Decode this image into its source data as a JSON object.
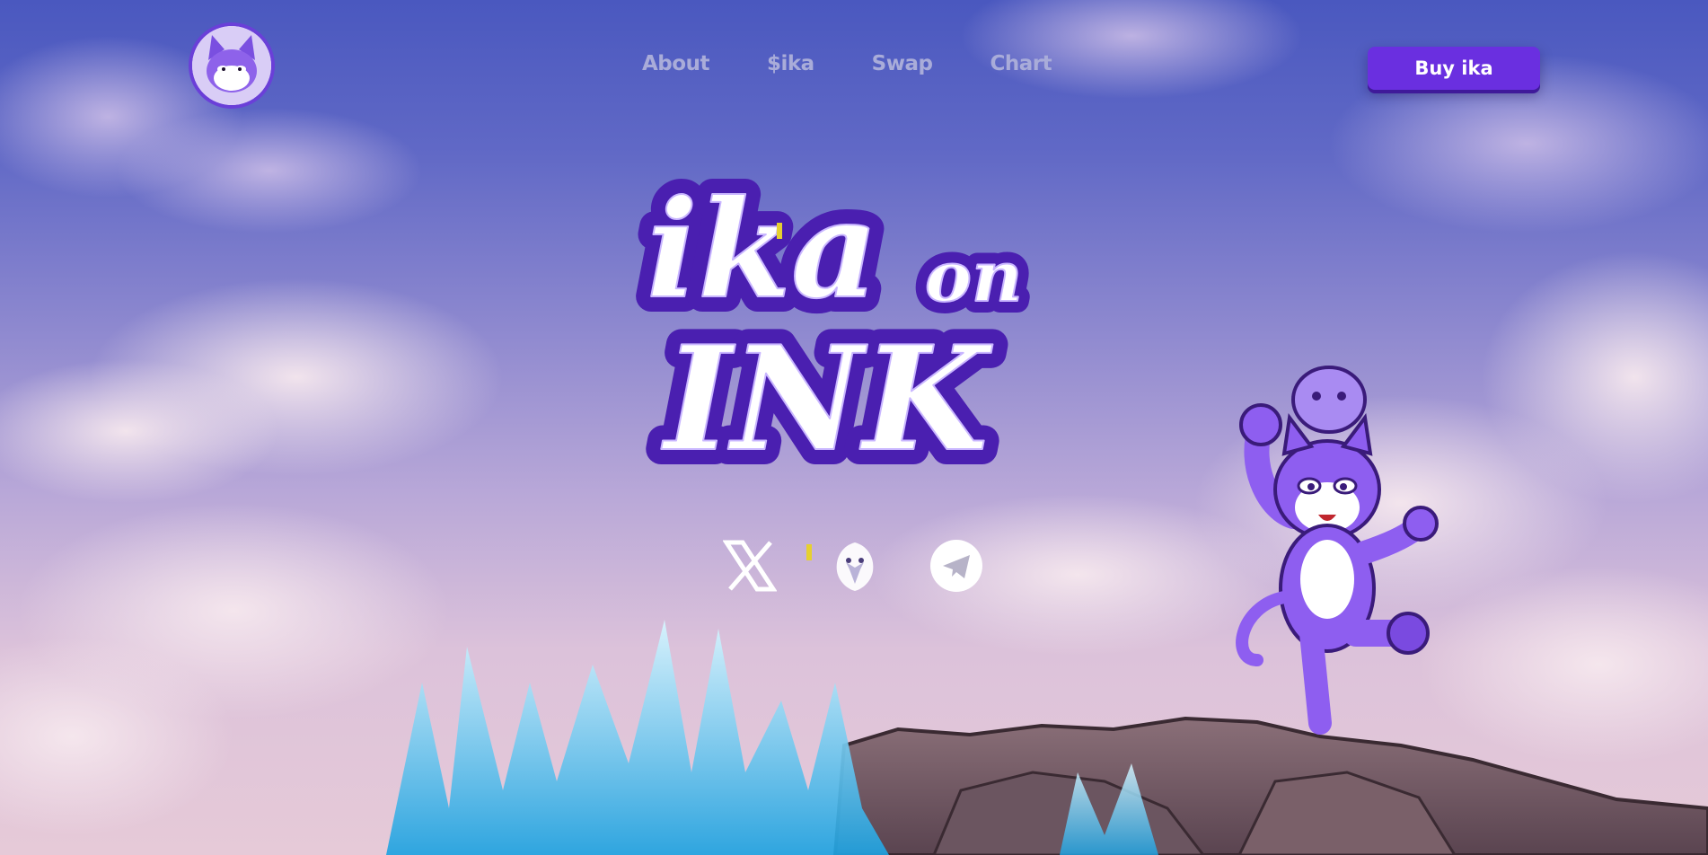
{
  "header": {
    "logo_icon": "cat-mascot-logo",
    "nav": [
      {
        "label": "About"
      },
      {
        "label": "$ika"
      },
      {
        "label": "Swap"
      },
      {
        "label": "Chart"
      }
    ],
    "buy_label": "Buy ika"
  },
  "hero": {
    "title_line1": "ika",
    "title_line1b": "on",
    "title_line2": "INK"
  },
  "socials": [
    {
      "icon": "x-logo-icon"
    },
    {
      "icon": "eagle-icon"
    },
    {
      "icon": "telegram-icon"
    }
  ],
  "colors": {
    "accent": "#6a2fe0",
    "title_fill": "#ffffff",
    "title_outline": "#5b2cc7",
    "nav_text": "#a9acd9"
  }
}
